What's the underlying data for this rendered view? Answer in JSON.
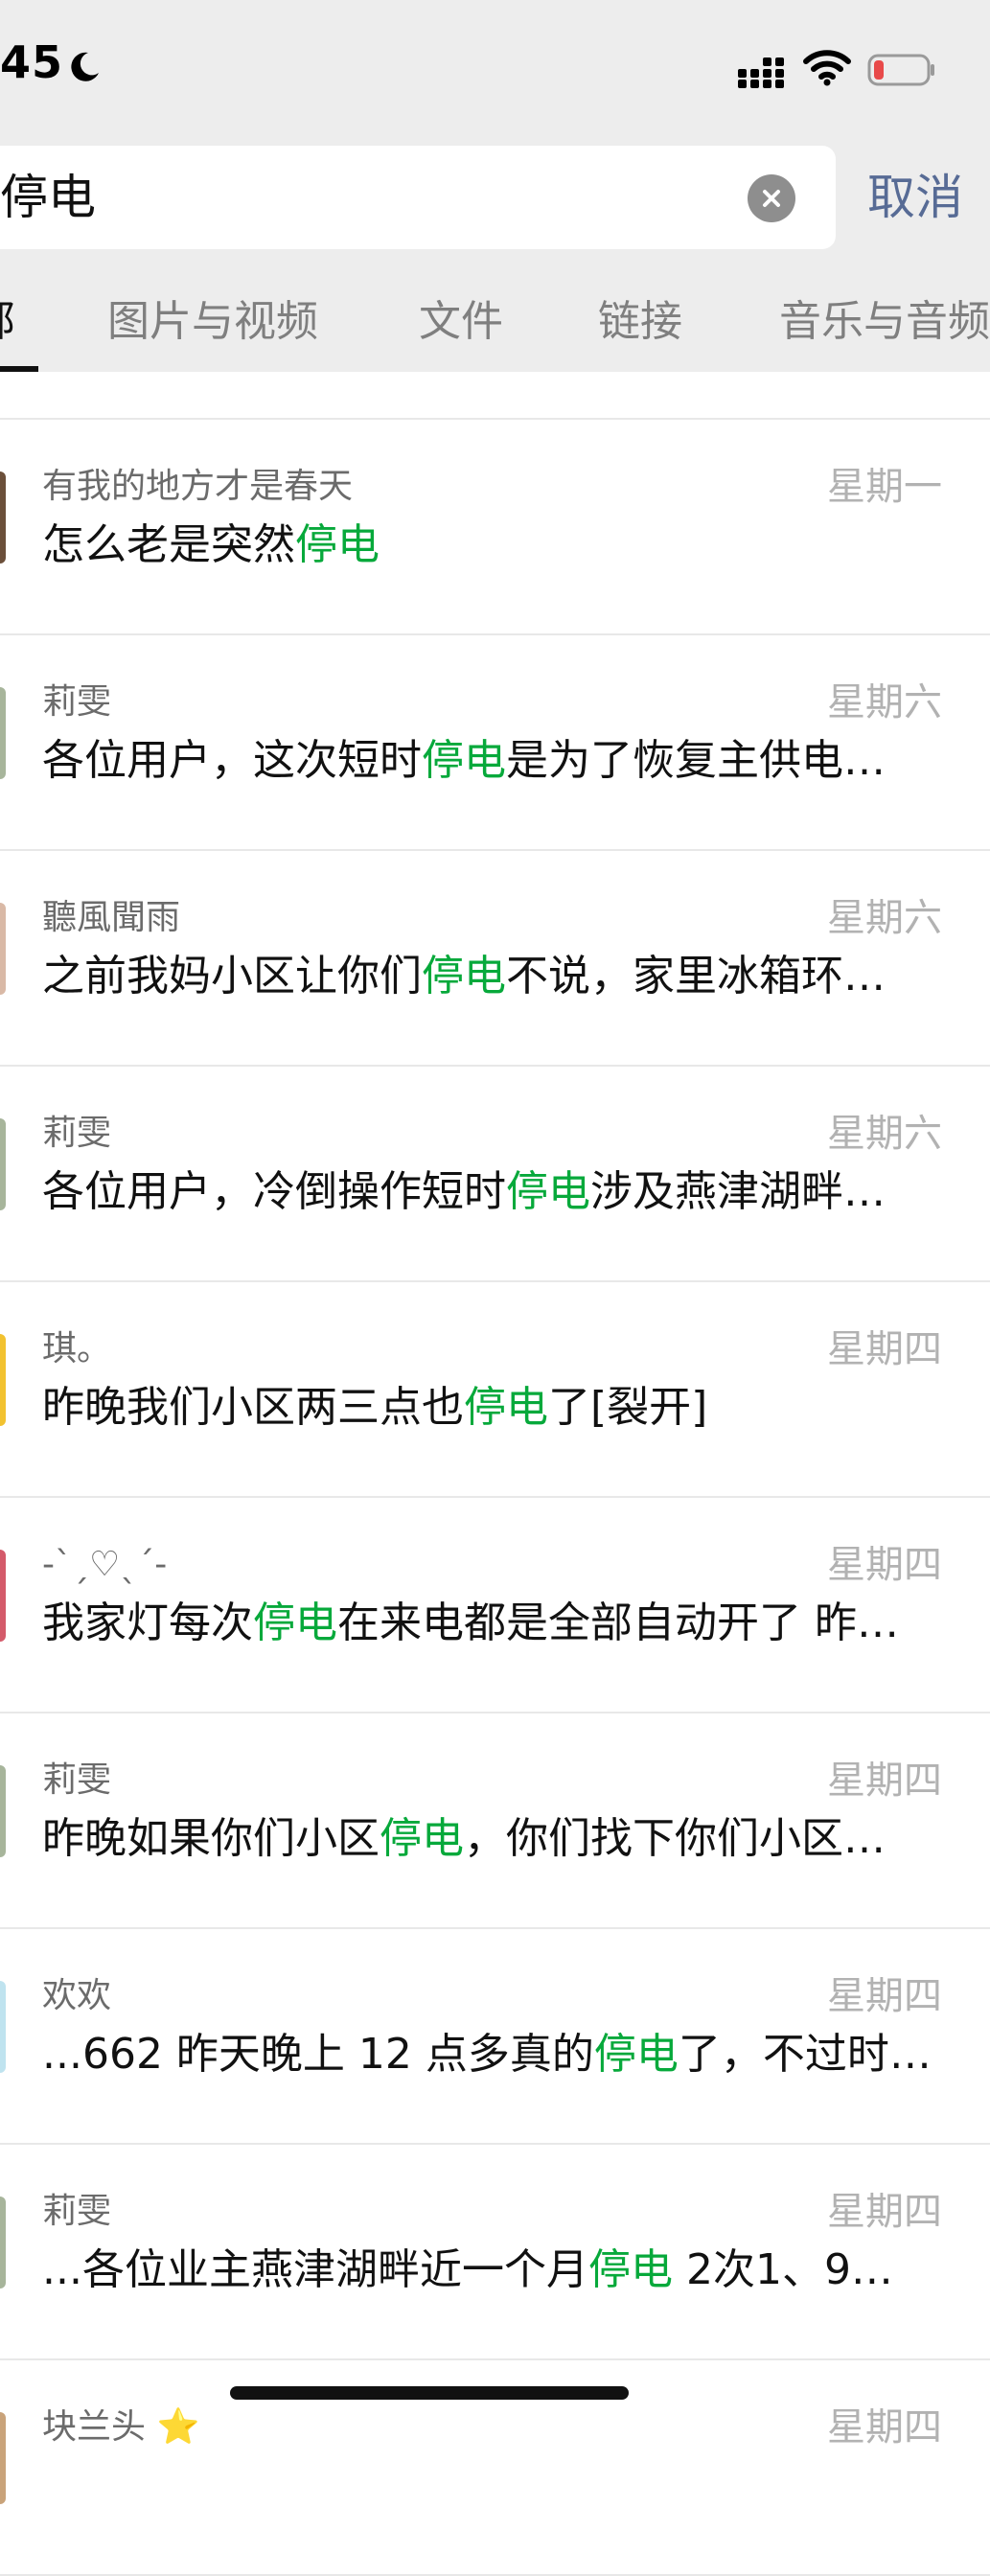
{
  "status_bar": {
    "time": "45",
    "icons": [
      "moon-icon",
      "signal-icon",
      "wifi-icon",
      "battery-low-icon"
    ],
    "battery_color": "#e84a4a"
  },
  "search": {
    "value": "停电",
    "clear_icon": "close-icon",
    "cancel_label": "取消"
  },
  "tabs": [
    {
      "label": "部",
      "active": true
    },
    {
      "label": "图片与视频",
      "active": false
    },
    {
      "label": "文件",
      "active": false
    },
    {
      "label": "链接",
      "active": false
    },
    {
      "label": "音乐与音频",
      "active": false
    }
  ],
  "highlight_color": "#07a93b",
  "results": [
    {
      "name": "有我的地方才是春天",
      "day": "星期一",
      "pre": "怎么老是突然",
      "hl": "停电",
      "post": "",
      "avatar_color": "#6b4f3a"
    },
    {
      "name": "莉雯",
      "day": "星期六",
      "pre": "各位用户，这次短时",
      "hl": "停电",
      "post": "是为了恢复主供电…",
      "avatar_color": "#a7b59b"
    },
    {
      "name": "聽風聞雨",
      "day": "星期六",
      "pre": "之前我妈小区让你们",
      "hl": "停电",
      "post": "不说，家里冰箱环…",
      "avatar_color": "#d9b9a6"
    },
    {
      "name": "莉雯",
      "day": "星期六",
      "pre": "各位用户，冷倒操作短时",
      "hl": "停电",
      "post": "涉及燕津湖畔…",
      "avatar_color": "#a7b59b"
    },
    {
      "name": "琪。",
      "day": "星期四",
      "pre": "昨晚我们小区两三点也",
      "hl": "停电",
      "post": "了[裂开]",
      "avatar_color": "#f2c230"
    },
    {
      "name": "-ˋˏ♡ˎˊ-",
      "day": "星期四",
      "pre": "我家灯每次",
      "hl": "停电",
      "post": "在来电都是全部自动开了 昨…",
      "avatar_color": "#d45a6a"
    },
    {
      "name": "莉雯",
      "day": "星期四",
      "pre": "昨晚如果你们小区",
      "hl": "停电",
      "post": "，你们找下你们小区…",
      "avatar_color": "#a7b59b"
    },
    {
      "name": "欢欢",
      "day": "星期四",
      "pre": "...662 昨天晚上 12 点多真的",
      "hl": "停电",
      "post": "了，不过时…",
      "avatar_color": "#bfe3ef"
    },
    {
      "name": "莉雯",
      "day": "星期四",
      "pre": "...各位业主燕津湖畔近一个月",
      "hl": "停电",
      "post": " 2次1、9…",
      "avatar_color": "#a7b59b"
    },
    {
      "name": "块兰头 ⭐",
      "day": "星期四",
      "pre": "",
      "hl": "",
      "post": "",
      "avatar_color": "#c9a37a"
    }
  ]
}
